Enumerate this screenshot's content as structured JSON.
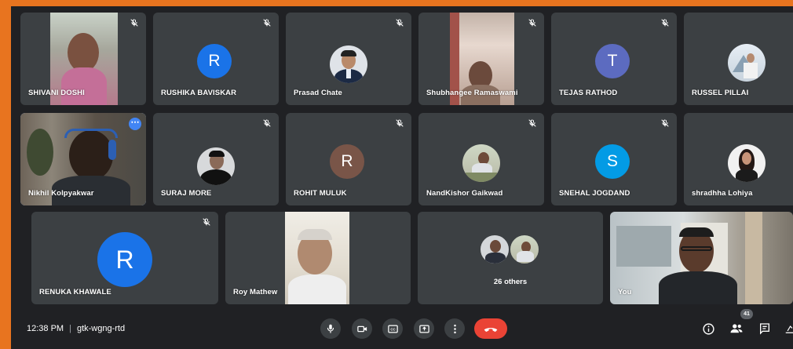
{
  "participants_row1": [
    {
      "name": "SHIVANI DOSHI",
      "kind": "video",
      "muted": true
    },
    {
      "name": "RUSHIKA BAVISKAR",
      "kind": "letter",
      "letter": "R",
      "color": "#1a73e8",
      "muted": true
    },
    {
      "name": "Prasad Chate",
      "kind": "photo",
      "muted": true
    },
    {
      "name": "Shubhangee Ramaswami",
      "kind": "video",
      "muted": true
    },
    {
      "name": "TEJAS RATHOD",
      "kind": "letter",
      "letter": "T",
      "color": "#5c6bc0",
      "muted": true
    },
    {
      "name": "RUSSEL PILLAI",
      "kind": "photo",
      "muted": true
    }
  ],
  "participants_row2": [
    {
      "name": "Nikhil Kolpyakwar",
      "kind": "video",
      "active": true
    },
    {
      "name": "SURAJ MORE",
      "kind": "photo",
      "muted": true
    },
    {
      "name": "ROHIT MULUK",
      "kind": "letter",
      "letter": "R",
      "color": "#795548",
      "muted": true
    },
    {
      "name": "NandKishor Gaikwad",
      "kind": "photo",
      "muted": true
    },
    {
      "name": "SNEHAL JOGDAND",
      "kind": "letter",
      "letter": "S",
      "color": "#039be5",
      "muted": true
    },
    {
      "name": "shradhha Lohiya",
      "kind": "photo",
      "muted": true
    }
  ],
  "participants_row3": [
    {
      "name": "RENUKA KHAWALE",
      "kind": "letter",
      "letter": "R",
      "color": "#1a73e8",
      "muted": true
    },
    {
      "name": "Roy Mathew",
      "kind": "video"
    },
    {
      "name": "26 others",
      "kind": "others"
    },
    {
      "name": "You",
      "kind": "video"
    }
  ],
  "bottom_bar": {
    "time": "12:38 PM",
    "separator": "|",
    "meeting_code": "gtk-wgng-rtd",
    "participant_count": "41"
  },
  "controls": [
    "microphone-icon",
    "camera-icon",
    "captions-icon",
    "present-icon",
    "more-options-icon",
    "end-call-icon"
  ],
  "right_icons": [
    "info-icon",
    "people-icon",
    "chat-icon",
    "activities-icon"
  ],
  "colors": {
    "frame": "#e8741f",
    "background": "#202124",
    "tile": "#3c4043",
    "end_call": "#ea4335",
    "active_border": "#8ab4f8"
  }
}
